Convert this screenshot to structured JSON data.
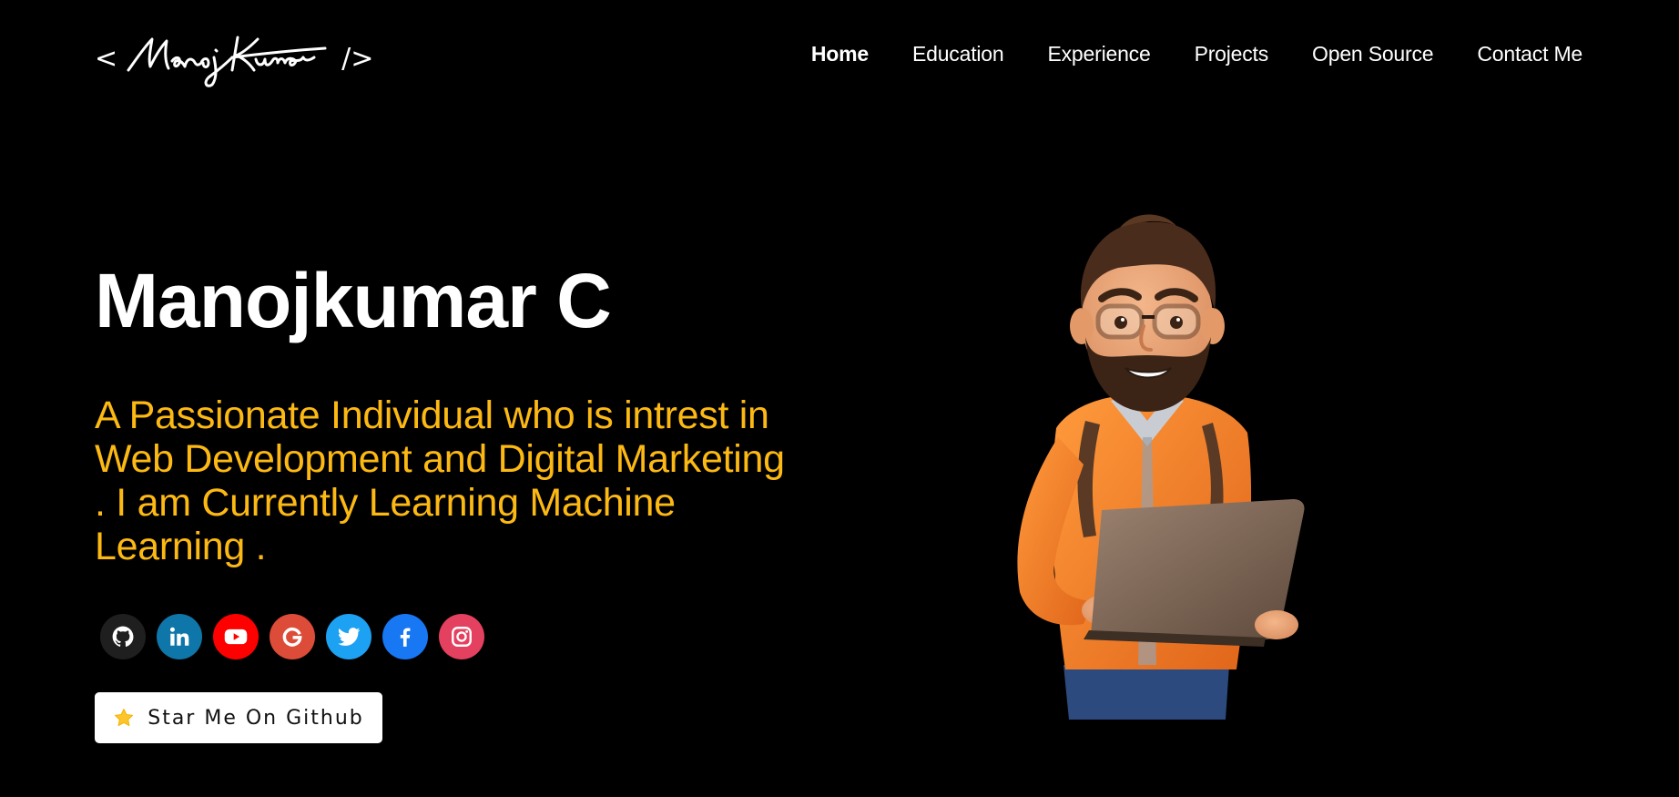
{
  "logo": {
    "open_bracket": "<",
    "close_bracket": "/>"
  },
  "nav": {
    "items": [
      {
        "label": "Home",
        "active": true
      },
      {
        "label": "Education",
        "active": false
      },
      {
        "label": "Experience",
        "active": false
      },
      {
        "label": "Projects",
        "active": false
      },
      {
        "label": "Open Source",
        "active": false
      },
      {
        "label": "Contact Me",
        "active": false
      }
    ]
  },
  "hero": {
    "name": "Manojkumar C",
    "subtitle": "A Passionate Individual who is intrest in Web Development and Digital Marketing . I am Currently Learning Machine Learning ."
  },
  "social": [
    {
      "icon": "github-icon",
      "color": "#1f1f1f"
    },
    {
      "icon": "linkedin-icon",
      "color": "#0e76a8"
    },
    {
      "icon": "youtube-icon",
      "color": "#ff0000"
    },
    {
      "icon": "google-icon",
      "color": "#dd4b39"
    },
    {
      "icon": "twitter-icon",
      "color": "#1da1f2"
    },
    {
      "icon": "facebook-icon",
      "color": "#1877f2"
    },
    {
      "icon": "instagram-icon",
      "color": "#e4405f"
    }
  ],
  "cta": {
    "label": "Star Me On Github",
    "icon": "star-icon"
  },
  "colors": {
    "background": "#000000",
    "accent": "#fdb913",
    "text": "#ffffff"
  }
}
